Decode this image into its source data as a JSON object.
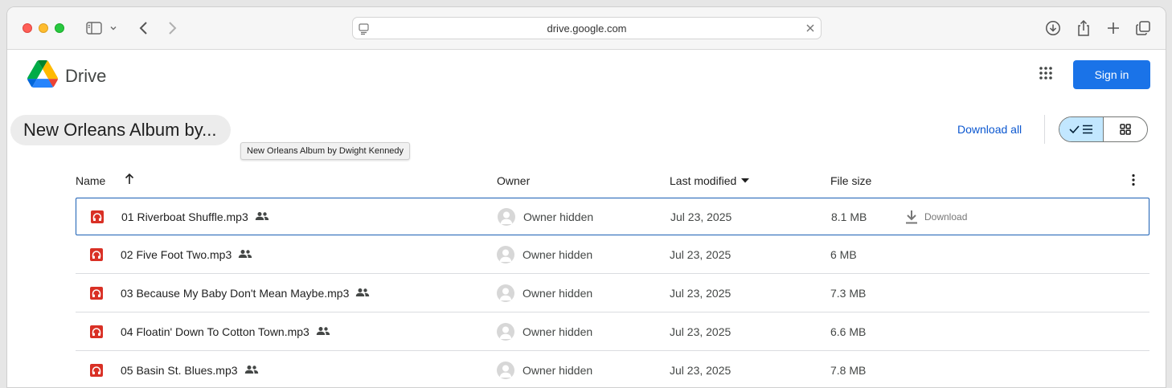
{
  "browser": {
    "url": "drive.google.com"
  },
  "header": {
    "brand": "Drive",
    "sign_in": "Sign in"
  },
  "folder": {
    "title": "New Orleans Album by...",
    "tooltip": "New Orleans Album by Dwight Kennedy",
    "download_all": "Download all"
  },
  "columns": {
    "name": "Name",
    "owner": "Owner",
    "modified": "Last modified",
    "size": "File size"
  },
  "row_action": "Download",
  "files": [
    {
      "name": "01 Riverboat Shuffle.mp3",
      "owner": "Owner hidden",
      "modified": "Jul 23, 2025",
      "size": "8.1 MB"
    },
    {
      "name": "02 Five Foot Two.mp3",
      "owner": "Owner hidden",
      "modified": "Jul 23, 2025",
      "size": "6 MB"
    },
    {
      "name": "03 Because My Baby Don't Mean Maybe.mp3",
      "owner": "Owner hidden",
      "modified": "Jul 23, 2025",
      "size": "7.3 MB"
    },
    {
      "name": "04 Floatin' Down To Cotton Town.mp3",
      "owner": "Owner hidden",
      "modified": "Jul 23, 2025",
      "size": "6.6 MB"
    },
    {
      "name": "05 Basin St. Blues.mp3",
      "owner": "Owner hidden",
      "modified": "Jul 23, 2025",
      "size": "7.8 MB"
    }
  ],
  "colors": {
    "accent": "#1a73e8",
    "audio_icon": "#d93025",
    "selected_toggle": "#c2e7ff"
  }
}
